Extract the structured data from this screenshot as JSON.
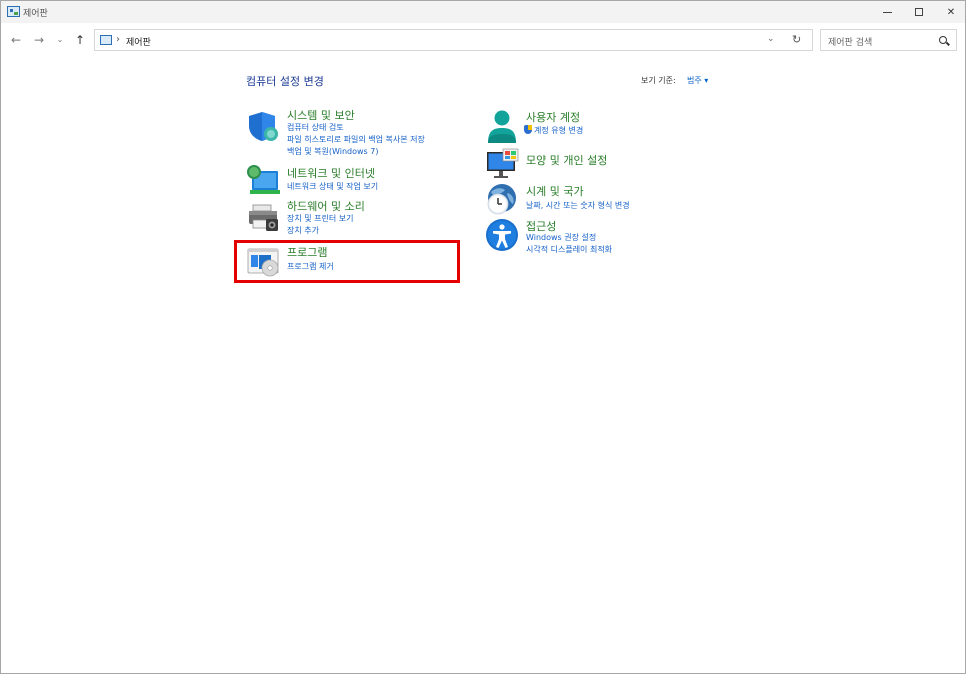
{
  "window": {
    "title": "제어판",
    "min_glyph": "",
    "max_glyph": "",
    "close_glyph": "✕"
  },
  "nav": {
    "back": "←",
    "forward": "→",
    "recent": "⌄",
    "up": "↑",
    "address_separator": "›",
    "address_text": "제어판",
    "address_dropdown": "⌄",
    "refresh": "↻",
    "search_placeholder": "제어판 검색"
  },
  "content": {
    "heading": "컴퓨터 설정 변경",
    "view_by_label": "보기 기준:",
    "view_by_value": "범주 ▾"
  },
  "left_categories": [
    {
      "icon": "shield-icon",
      "title": "시스템 및 보안",
      "links": [
        "컴퓨터 상태 검토",
        "파일 히스토리로 파일의 백업 복사본 저장",
        "백업 및 복원(Windows 7)"
      ]
    },
    {
      "icon": "network-icon",
      "title": "네트워크 및 인터넷",
      "links": [
        "네트워크 상태 및 작업 보기"
      ]
    },
    {
      "icon": "printer-icon",
      "title": "하드웨어 및 소리",
      "links": [
        "장치 및 프린터 보기",
        "장치 추가"
      ]
    },
    {
      "icon": "programs-icon",
      "title": "프로그램",
      "links": [
        "프로그램 제거"
      ]
    }
  ],
  "right_categories": [
    {
      "icon": "user-icon",
      "title": "사용자 계정",
      "links": [
        "계정 유형 변경"
      ]
    },
    {
      "icon": "appearance-icon",
      "title": "모양 및 개인 설정",
      "links": []
    },
    {
      "icon": "clock-globe-icon",
      "title": "시계 및 국가",
      "links": [
        "날짜, 시간 또는 숫자 형식 변경"
      ]
    },
    {
      "icon": "accessibility-icon",
      "title": "접근성",
      "links": [
        "Windows 권장 설정",
        "시각적 디스플레이 최적화"
      ]
    }
  ],
  "colors": {
    "category_title": "#2a7d2a",
    "link": "#1560c8",
    "heading": "#1e3c96",
    "highlight_box": "#e50000"
  }
}
